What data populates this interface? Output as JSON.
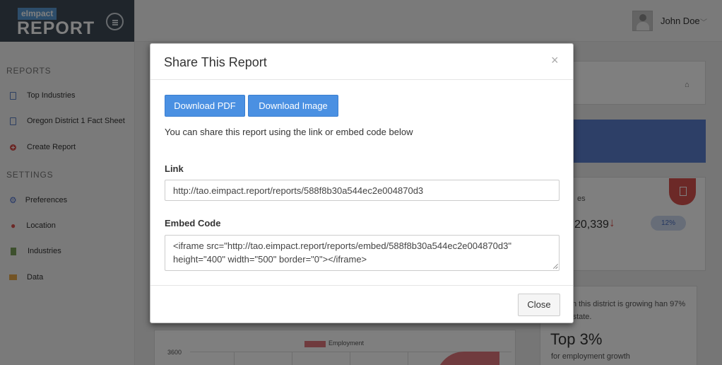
{
  "brand": {
    "small": "eImpact",
    "big": "REPORT"
  },
  "topbar": {
    "user_name": "John Doe"
  },
  "sidebar": {
    "reports_label": "REPORTS",
    "reports_items": [
      {
        "label": "Top Industries",
        "icon": "document-icon"
      },
      {
        "label": "Oregon District 1 Fact Sheet",
        "icon": "document-icon"
      },
      {
        "label": "Create Report",
        "icon": "plus-circle-icon"
      }
    ],
    "settings_label": "SETTINGS",
    "settings_items": [
      {
        "label": "Preferences",
        "icon": "gears-icon"
      },
      {
        "label": "Location",
        "icon": "map-pin-icon"
      },
      {
        "label": "Industries",
        "icon": "bar-chart-icon"
      },
      {
        "label": "Data",
        "icon": "database-icon"
      }
    ]
  },
  "background": {
    "stat_label": "es",
    "stat_value": "20,339",
    "stat_pct": "12%",
    "growth_text": "ment in this district is growing han 97% of the state.",
    "growth_big": "Top 3%",
    "growth_sub": "for employment growth",
    "chart_legend": "Employment",
    "chart_tick": "3600"
  },
  "modal": {
    "title": "Share This Report",
    "close_symbol": "×",
    "download_pdf_label": "Download PDF",
    "download_image_label": "Download Image",
    "description": "You can share this report using the link or embed code below",
    "link_label": "Link",
    "link_value": "http://tao.eimpact.report/reports/588f8b30a544ec2e004870d3",
    "embed_label": "Embed Code",
    "embed_value": "<iframe src=\"http://tao.eimpact.report/reports/embed/588f8b30a544ec2e004870d3\" height=\"400\" width=\"500\" border=\"0\"></iframe>",
    "close_button_label": "Close"
  },
  "colors": {
    "primary": "#4a90e2",
    "sidebar_brand_bg": "#3e4a57",
    "accent_red": "#d9534f",
    "banner_blue": "#5b7fcf"
  }
}
